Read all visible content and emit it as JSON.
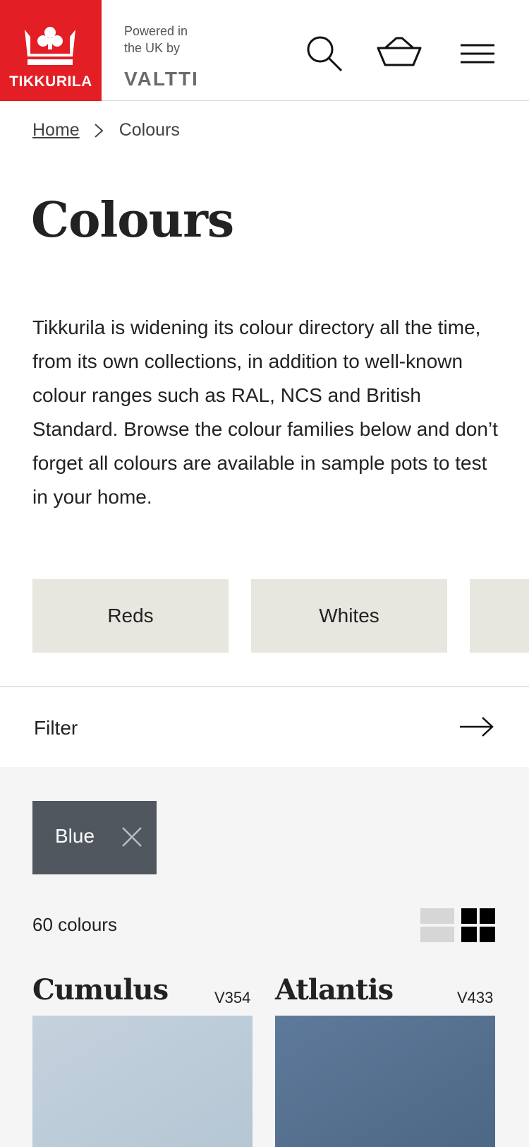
{
  "brand": {
    "logo_text": "TIKKURILA",
    "powered_text": "Powered in the UK by",
    "partner": "VALTTI",
    "red": "#e31e24"
  },
  "header": {
    "icons": [
      "search-icon",
      "basket-icon",
      "menu-icon"
    ]
  },
  "breadcrumb": {
    "home": "Home",
    "current": "Colours"
  },
  "page": {
    "title": "Colours",
    "intro": "Tikkurila is widening its colour directory all the time, from its own collections, in addition to well-known colour ranges such as RAL, NCS and British Standard. Browse the colour families below and don’t forget all colours are available in sample pots to test in your home."
  },
  "families": [
    {
      "label": "Reds"
    },
    {
      "label": "Whites"
    },
    {
      "label": ""
    }
  ],
  "filter": {
    "label": "Filter",
    "active_chip": "Blue"
  },
  "results": {
    "count_text": "60 colours",
    "view_modes": [
      "list-view-icon",
      "grid-view-icon"
    ],
    "selected_view": "grid"
  },
  "colours": [
    {
      "name": "Cumulus",
      "code": "V354",
      "hex_top": "#c4d2dd",
      "hex_bottom": "#b5c6d4"
    },
    {
      "name": "Atlantis",
      "code": "V433",
      "hex_top": "#5e7a9a",
      "hex_bottom": "#4d6786"
    }
  ]
}
